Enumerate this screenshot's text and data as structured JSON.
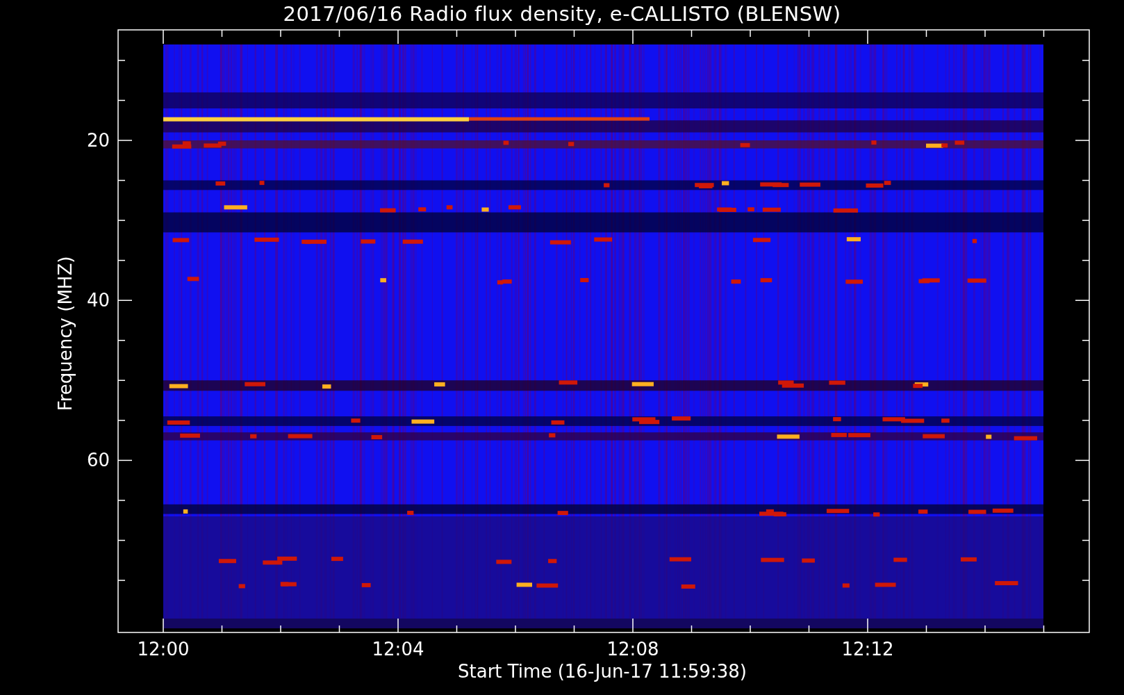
{
  "title": "2017/06/16  Radio flux density, e-CALLISTO (BLENSW)",
  "x_axis": {
    "label": "Start Time (16-Jun-17 11:59:38)",
    "ticks": [
      "12:00",
      "12:04",
      "12:08",
      "12:12"
    ]
  },
  "y_axis": {
    "label": "Frequency (MHZ)",
    "ticks": [
      "20",
      "40",
      "60"
    ]
  }
}
